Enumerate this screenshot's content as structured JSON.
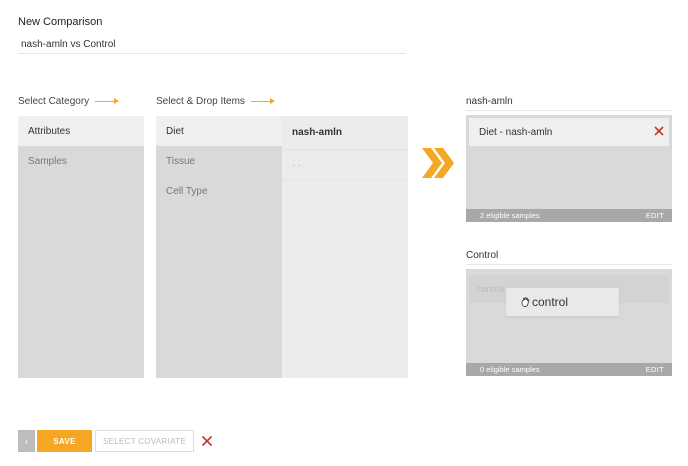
{
  "header": {
    "title": "New Comparison",
    "name_value": "nash-amln vs Control"
  },
  "category": {
    "label": "Select Category",
    "items": [
      "Attributes",
      "Samples"
    ]
  },
  "items": {
    "label": "Select & Drop Items",
    "list": [
      "Diet",
      "Tissue",
      "Cell Type"
    ],
    "drop_header": "nash-amln",
    "drop_placeholder": "- -"
  },
  "groups": {
    "group1": {
      "name": "nash-amln",
      "chip": "Diet - nash-amln",
      "footer_count": "2 eligible samples",
      "edit": "EDIT"
    },
    "group2": {
      "name": "Control",
      "placeholder": "control",
      "footer_count": "0 eligible samples",
      "edit": "EDIT"
    }
  },
  "drag": {
    "label": "control"
  },
  "buttons": {
    "back": "‹",
    "save": "SAVE",
    "select_covariate": "SELECT COVARIATE"
  },
  "colors": {
    "accent": "#f5a623",
    "danger": "#c0392b",
    "panel": "#d9d9d9",
    "footer": "#a8a8a8"
  }
}
